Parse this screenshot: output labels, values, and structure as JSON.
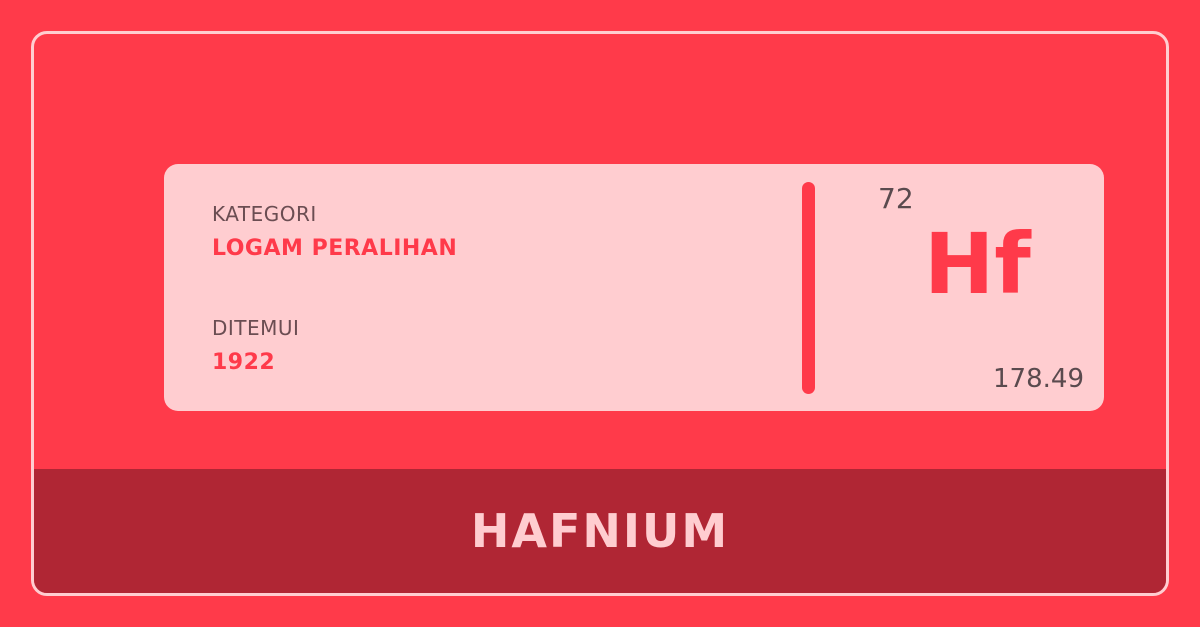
{
  "card": {
    "category_label": "KATEGORI",
    "category_value": "LOGAM PERALIHAN",
    "discovered_label": "DITEMUI",
    "discovered_value": "1922",
    "atomic_number": "72",
    "symbol": "Hf",
    "atomic_mass": "178.49"
  },
  "footer": {
    "element_name": "HAFNIUM"
  },
  "colors": {
    "background": "#ff3a4a",
    "card": "#ffcdd0",
    "footer": "#b02634",
    "accent": "#ff3a4a",
    "muted_text": "#5a4a4e"
  }
}
